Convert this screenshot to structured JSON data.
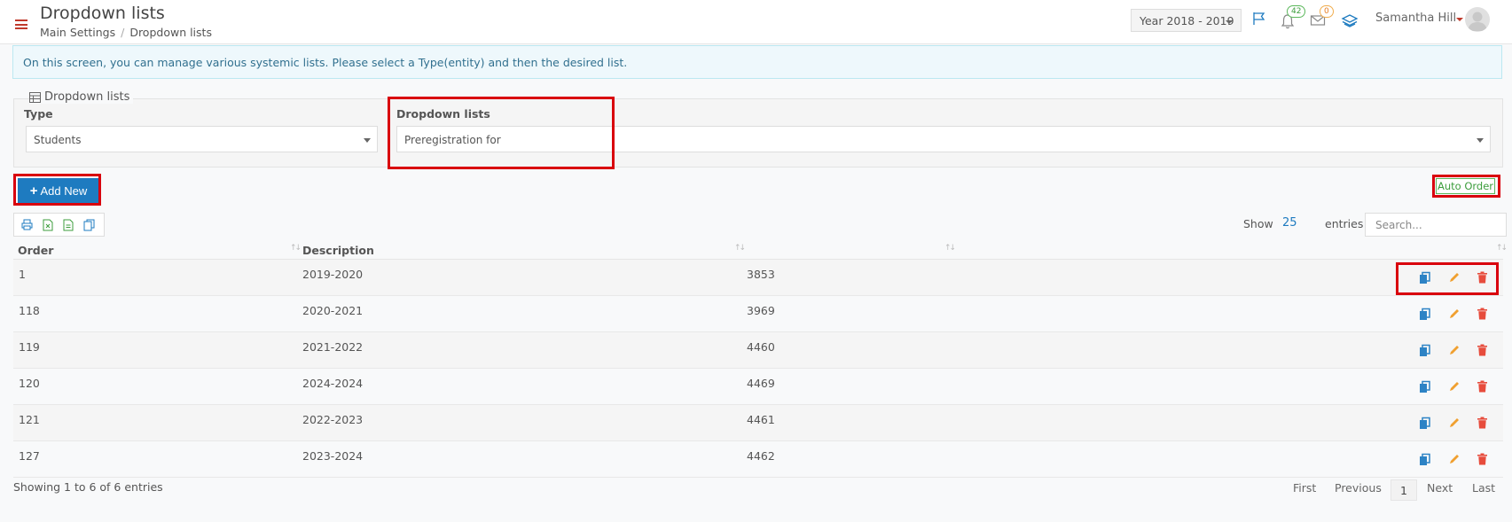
{
  "header": {
    "title": "Dropdown lists",
    "breadcrumb": [
      "Main Settings",
      "Dropdown lists"
    ],
    "year_select": "Year 2018 - 2019",
    "notifications_count": "42",
    "messages_count": "0",
    "user_name": "Samantha Hill"
  },
  "info_alert": "On this screen, you can manage various systemic lists. Please select a Type(entity) and then the desired list.",
  "filters": {
    "legend": "Dropdown lists",
    "type_label": "Type",
    "type_value": "Students",
    "list_label": "Dropdown lists",
    "list_value": "Preregistration for"
  },
  "toolbar": {
    "add_new_label": "Add New",
    "auto_order_label": "Auto Order",
    "show_label": "Show",
    "show_value": "25",
    "entries_label": "entries",
    "search_placeholder": "Search..."
  },
  "table": {
    "columns": [
      "Order",
      "Description",
      "",
      ""
    ],
    "rows": [
      {
        "order": "1",
        "description": "2019-2020",
        "code": "3853"
      },
      {
        "order": "118",
        "description": "2020-2021",
        "code": "3969"
      },
      {
        "order": "119",
        "description": "2021-2022",
        "code": "4460"
      },
      {
        "order": "120",
        "description": "2024-2024",
        "code": "4469"
      },
      {
        "order": "121",
        "description": "2022-2023",
        "code": "4461"
      },
      {
        "order": "127",
        "description": "2023-2024",
        "code": "4462"
      }
    ]
  },
  "footer": {
    "showing_text": "Showing 1 to 6 of 6 entries",
    "pager": {
      "first": "First",
      "previous": "Previous",
      "current": "1",
      "next": "Next",
      "last": "Last"
    }
  },
  "colors": {
    "primary": "#1e7bc0",
    "highlight": "#d9000d",
    "success": "#5cb85c",
    "edit": "#f0a030",
    "delete": "#e74c3c"
  },
  "icons": {
    "menu": "hamburger-icon",
    "flag": "flag-icon",
    "bell": "bell-icon",
    "mail": "envelope-icon",
    "stack": "layers-icon",
    "copy": "copy-icon",
    "edit": "pencil-icon",
    "delete": "trash-icon"
  }
}
